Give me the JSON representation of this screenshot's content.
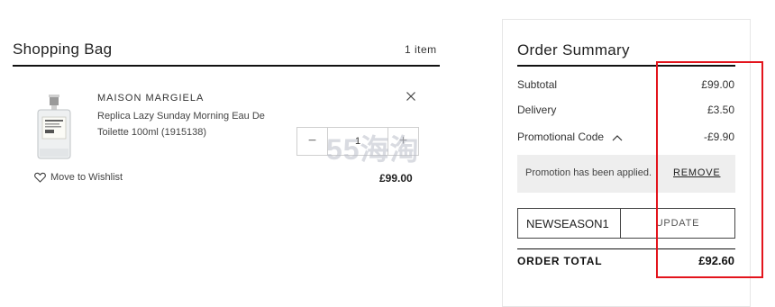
{
  "bag": {
    "title": "Shopping Bag",
    "count": "1 item",
    "item": {
      "brand": "MAISON MARGIELA",
      "name": "Replica Lazy Sunday Morning Eau De Toilette 100ml (1915138)",
      "quantity": "1",
      "price": "£99.00",
      "wishlist_label": "Move to Wishlist",
      "minus_label": "−",
      "plus_label": "+"
    }
  },
  "summary": {
    "title": "Order Summary",
    "rows": [
      {
        "label": "Subtotal",
        "value": "£99.00"
      },
      {
        "label": "Delivery",
        "value": "£3.50"
      },
      {
        "label": "Promotional Code",
        "value": "-£9.90"
      }
    ],
    "promo_message": "Promotion has been applied.",
    "promo_remove": "REMOVE",
    "code_value": "NEWSEASON1",
    "update_label": "UPDATE",
    "total_label": "ORDER TOTAL",
    "total_value": "£92.60"
  },
  "watermark": "55海淘",
  "colors": {
    "accent": "#111111",
    "highlight": "#e3141c",
    "promo_bg": "#eeeeee"
  },
  "icons": [
    "close-icon",
    "heart-icon",
    "chevron-up-icon",
    "perfume-bottle-image"
  ]
}
